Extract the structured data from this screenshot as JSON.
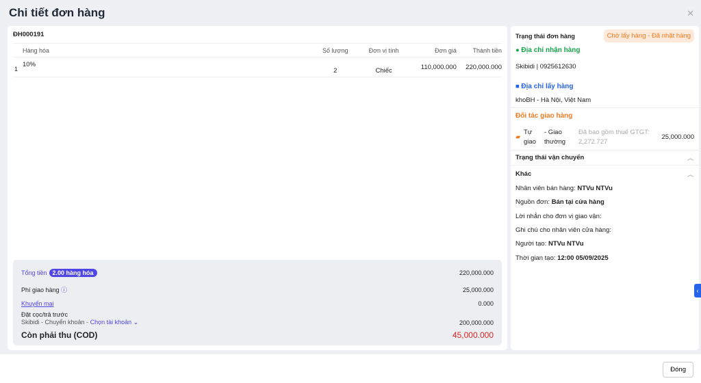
{
  "title": "Chi tiết đơn hàng",
  "order_code": "ĐH000191",
  "table": {
    "headers": [
      "Hàng hóa",
      "Số lượng",
      "Đơn vị tính",
      "Đơn giá",
      "Thành tiền"
    ],
    "rows": [
      {
        "index": "1",
        "name": "10%",
        "qty": "2",
        "unit": "Chiếc",
        "price": "110,000.000",
        "total": "220,000.000"
      }
    ]
  },
  "summary": {
    "total_label": "Tổng tiền",
    "total_badge": "2.00 hàng hóa",
    "total_value": "220,000.000",
    "shipping_label": "Phí giao hàng",
    "shipping_value": "25,000.000",
    "promo_label": "Khuyến mại",
    "promo_value": "0.000",
    "deposit_label": "Đặt cọc/trả trước",
    "deposit_detail": "Skibidi - Chuyển khoản -",
    "deposit_account": "Chọn tài khoản",
    "deposit_value": "200,000.000",
    "cod_label": "Còn phải thu (COD)",
    "cod_value": "45,000.000"
  },
  "status": {
    "label": "Trạng thái đơn hàng",
    "value": "Chờ lấy hàng - Đã nhặt hàng"
  },
  "receive": {
    "title": "Địa chỉ nhận hàng",
    "value": "Skibidi | 0925612630"
  },
  "pickup": {
    "title": "Địa chỉ lấy hàng",
    "value": "khoBH - Hà Nội, Việt Nam"
  },
  "partner": {
    "title": "Đối tác giao hàng",
    "name": "Tự giao",
    "service": "- Giao thường",
    "tax": "Đã bao gồm thuế GTGT: 2,272.727",
    "fee": "25,000.000"
  },
  "shipping_status": "Trạng thái vận chuyển",
  "other": {
    "title": "Khác",
    "items": [
      {
        "label": "Nhân viên bán hàng: ",
        "value": "NTVu NTVu"
      },
      {
        "label": "Nguồn đơn: ",
        "value": "Bán tại cửa hàng"
      },
      {
        "label": "Lời nhắn cho đơn vị giao vận:",
        "value": ""
      },
      {
        "label": "Ghi chú cho nhân viên cửa hàng:",
        "value": ""
      },
      {
        "label": "Người tạo: ",
        "value": "NTVu NTVu"
      },
      {
        "label": "Thời gian tạo: ",
        "value": "12:00 05/09/2025"
      }
    ]
  },
  "close_button": "Đóng"
}
